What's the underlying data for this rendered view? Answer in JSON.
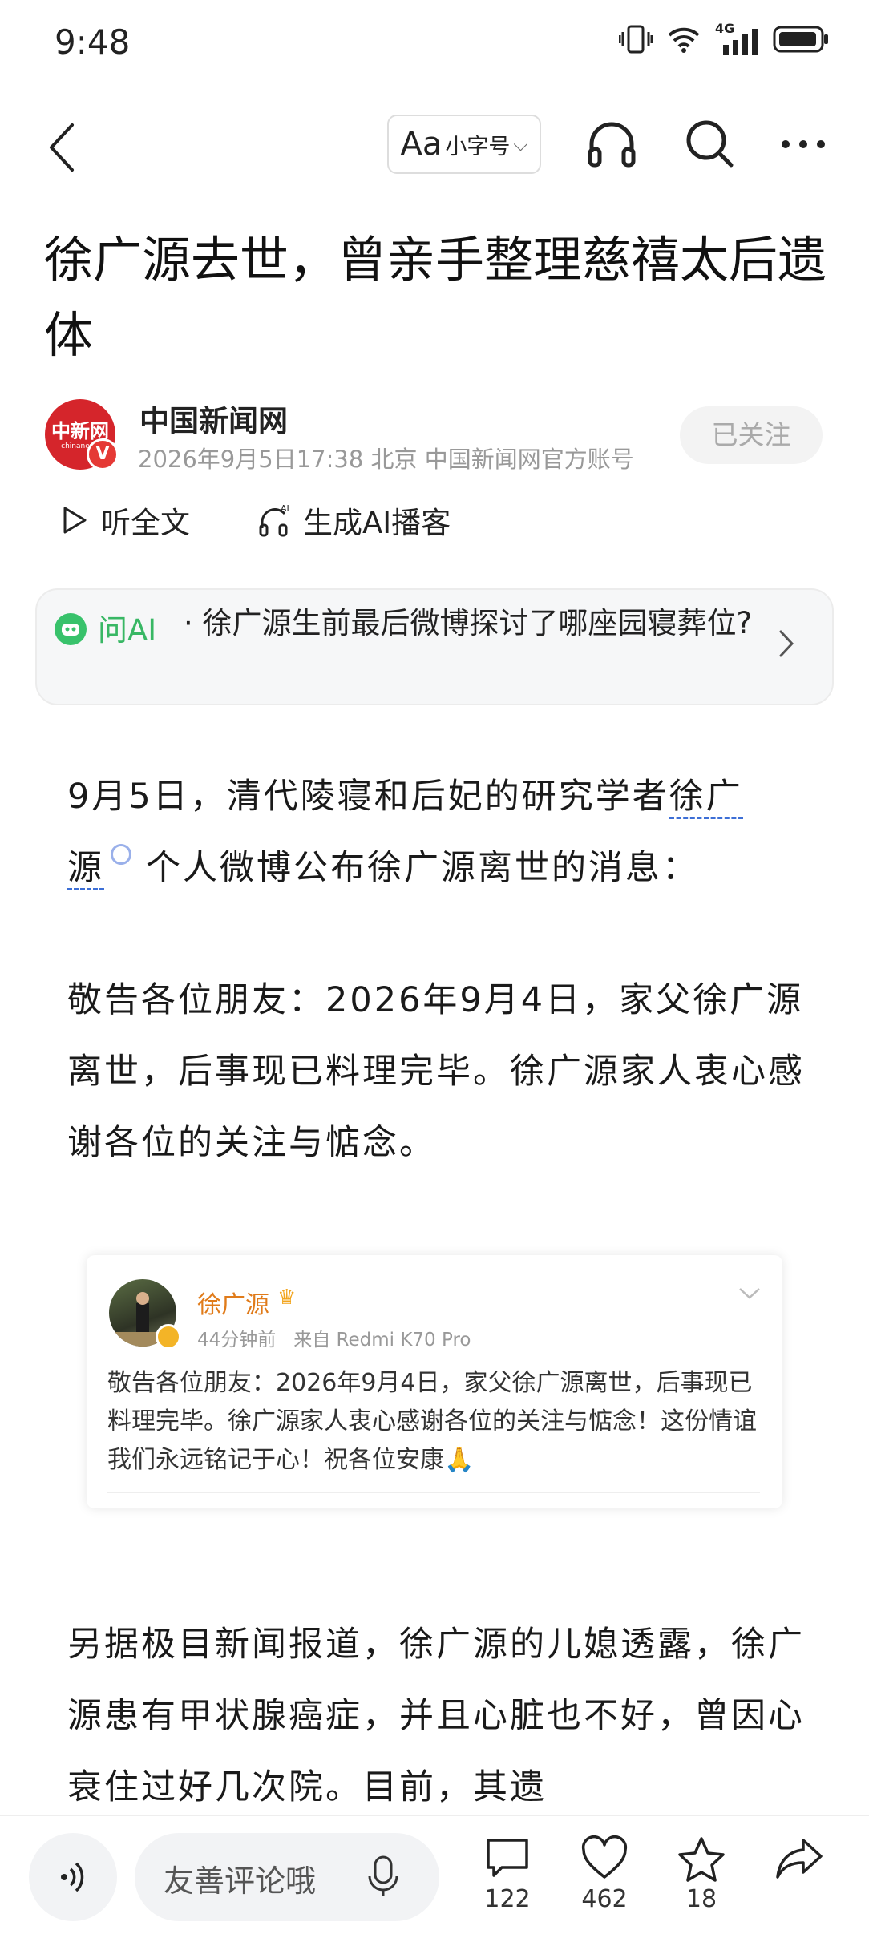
{
  "status_bar": {
    "time": "9:48",
    "network": "4G"
  },
  "nav": {
    "font_aa": "Aa",
    "font_label": "小字号"
  },
  "article": {
    "title": "徐广源去世，曾亲手整理慈禧太后遗体",
    "source": "中国新闻网",
    "meta": "2026年9月5日17:38 北京 中国新闻网官方账号",
    "follow_label": "已关注",
    "listen_label": "听全文",
    "podcast_label": "生成AI播客",
    "logo_text": "中新网",
    "logo_subtext": "chinanews"
  },
  "ask_ai": {
    "label": "问AI",
    "question": "· 徐广源生前最后微博探讨了哪座园寝葬位?"
  },
  "body": {
    "p1_a": "9月5日，清代陵寝和后妃的研究学者",
    "p1_link1": "徐广",
    "p1_link2": "源",
    "p1_b": "个人微博公布徐广源离世的消息：",
    "p2": "敬告各位朋友：2026年9月4日，家父徐广源离世，后事现已料理完毕。徐广源家人衷心感谢各位的关注与惦念。",
    "p3": "另据极目新闻报道，徐广源的儿媳透露，徐广源患有甲状腺癌症，并且心脏也不好，曾因心衰住过好几次院。目前，其遗"
  },
  "embedded_post": {
    "name": "徐广源",
    "time": "44分钟前",
    "device": "来自 Redmi K70 Pro",
    "text": "敬告各位朋友：2026年9月4日，家父徐广源离世，后事现已料理完毕。徐广源家人衷心感谢各位的关注与惦念！这份情谊我们永远铭记于心！祝各位安康🙏"
  },
  "bottom_bar": {
    "comment_placeholder": "友善评论哦",
    "comments": "122",
    "likes": "462",
    "favorites": "18"
  },
  "colors": {
    "accent_green": "#38b764",
    "link_blue": "#3d6fd6",
    "weibo_orange": "#e07b1a"
  }
}
